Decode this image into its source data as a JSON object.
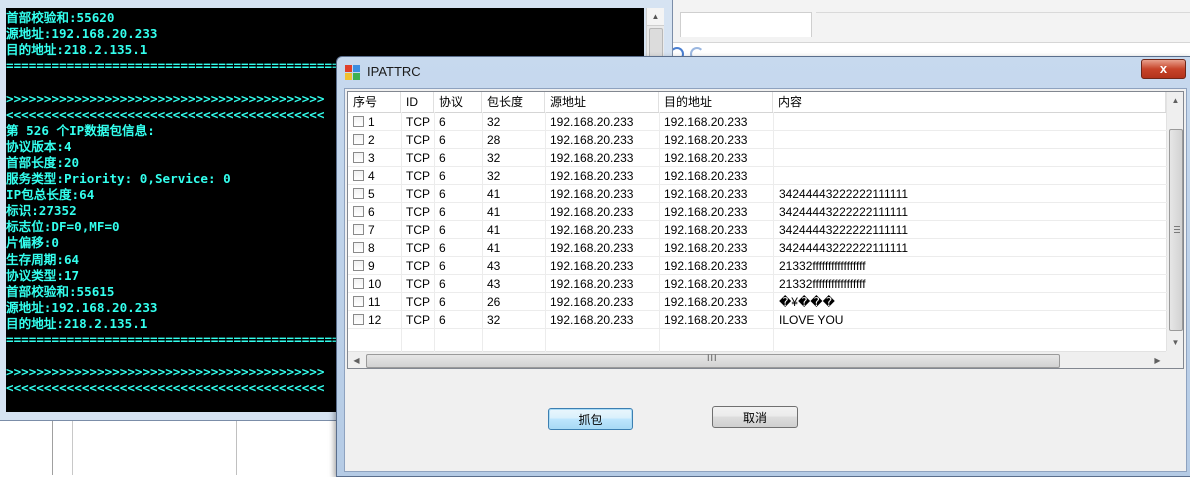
{
  "console": {
    "lines": [
      "首部校验和:55620",
      "源地址:192.168.20.233",
      "目的地址:218.2.135.1",
      "================================================================================",
      "",
      ">>>>>>>>>>>>>>>>>>>>>>>>>>>>>>>>>>>>>>>>>>",
      "<<<<<<<<<<<<<<<<<<<<<<<<<<<<<<<<<<<<<<<<<<",
      "第 526 个IP数据包信息:",
      "协议版本:4",
      "首部长度:20",
      "服务类型:Priority: 0,Service: 0",
      "IP包总长度:64",
      "标识:27352",
      "标志位:DF=0,MF=0",
      "片偏移:0",
      "生存周期:64",
      "协议类型:17",
      "首部校验和:55615",
      "源地址:192.168.20.233",
      "目的地址:218.2.135.1",
      "================================================================================",
      "",
      ">>>>>>>>>>>>>>>>>>>>>>>>>>>>>>>>>>>>>>>>>>",
      "<<<<<<<<<<<<<<<<<<<<<<<<<<<<<<<<<<<<<<<<<<"
    ],
    "text_color": "#33ffee"
  },
  "dialog": {
    "title": "IPATTRC",
    "close_label": "x",
    "columns": [
      "序号",
      "ID",
      "协议",
      "包长度",
      "源地址",
      "目的地址",
      "内容"
    ],
    "rows": [
      [
        "1",
        "TCP",
        "6",
        "32",
        "192.168.20.233",
        "192.168.20.233",
        ""
      ],
      [
        "2",
        "TCP",
        "6",
        "28",
        "192.168.20.233",
        "192.168.20.233",
        ""
      ],
      [
        "3",
        "TCP",
        "6",
        "32",
        "192.168.20.233",
        "192.168.20.233",
        ""
      ],
      [
        "4",
        "TCP",
        "6",
        "32",
        "192.168.20.233",
        "192.168.20.233",
        ""
      ],
      [
        "5",
        "TCP",
        "6",
        "41",
        "192.168.20.233",
        "192.168.20.233",
        "34244443222222111111"
      ],
      [
        "6",
        "TCP",
        "6",
        "41",
        "192.168.20.233",
        "192.168.20.233",
        "34244443222222111111"
      ],
      [
        "7",
        "TCP",
        "6",
        "41",
        "192.168.20.233",
        "192.168.20.233",
        "34244443222222111111"
      ],
      [
        "8",
        "TCP",
        "6",
        "41",
        "192.168.20.233",
        "192.168.20.233",
        "34244443222222111111"
      ],
      [
        "9",
        "TCP",
        "6",
        "43",
        "192.168.20.233",
        "192.168.20.233",
        "21332fffffffffffffffff"
      ],
      [
        "10",
        "TCP",
        "6",
        "43",
        "192.168.20.233",
        "192.168.20.233",
        "21332fffffffffffffffff"
      ],
      [
        "11",
        "TCP",
        "6",
        "26",
        "192.168.20.233",
        "192.168.20.233",
        "�¥���"
      ],
      [
        "12",
        "TCP",
        "6",
        "32",
        "192.168.20.233",
        "192.168.20.233",
        "ILOVE  YOU"
      ]
    ],
    "hscroll_grip": "III",
    "capture_button": "抓包",
    "cancel_button": "取消"
  }
}
